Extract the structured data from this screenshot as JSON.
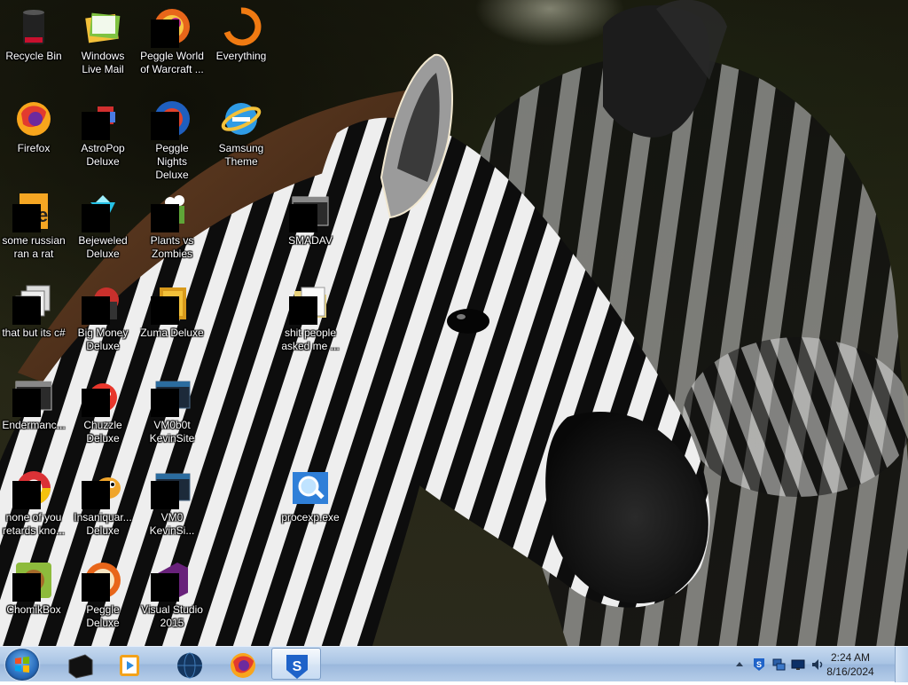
{
  "desktop": {
    "icons": [
      {
        "label": "Recycle Bin",
        "icon": "recycle-bin-icon",
        "redacted": false
      },
      {
        "label": "Windows Live Mail",
        "icon": "windows-live-mail-icon",
        "redacted": false
      },
      {
        "label": "Peggle World of Warcraft ...",
        "icon": "peggle-wow-icon",
        "redacted": true
      },
      {
        "label": "Everything",
        "icon": "everything-search-icon",
        "redacted": false
      },
      {
        "label": "Firefox",
        "icon": "firefox-icon",
        "redacted": false
      },
      {
        "label": "AstroPop Deluxe",
        "icon": "astropop-icon",
        "redacted": true
      },
      {
        "label": "Peggle Nights Deluxe",
        "icon": "peggle-nights-icon",
        "redacted": true
      },
      {
        "label": "Samsung Theme",
        "icon": "ie-icon",
        "redacted": false
      },
      {
        "label": "some russian ran a rat",
        "icon": "shortcut-icon",
        "redacted": true
      },
      {
        "label": "Bejeweled Deluxe",
        "icon": "bejeweled-icon",
        "redacted": true
      },
      {
        "label": "Plants vs Zombies",
        "icon": "plants-vs-zombies-icon",
        "redacted": true
      },
      {
        "label": "SMADAV",
        "icon": "app-window-icon",
        "redacted": true
      },
      {
        "label": "that but its c#",
        "icon": "stacked-files-icon",
        "redacted": true
      },
      {
        "label": "Big Money Deluxe",
        "icon": "big-money-icon",
        "redacted": true
      },
      {
        "label": "Zuma Deluxe",
        "icon": "zuma-icon",
        "redacted": true
      },
      {
        "label": "shit people asked me ...",
        "icon": "folder-icon",
        "redacted": true
      },
      {
        "label": "Endermanc...",
        "icon": "app-window-icon",
        "redacted": true
      },
      {
        "label": "Chuzzle Deluxe",
        "icon": "chuzzle-icon",
        "redacted": true
      },
      {
        "label": "VM0b0t KevinSite",
        "icon": "vm-icon",
        "redacted": true
      },
      {
        "label": "none of you retards kno...",
        "icon": "chrome-icon",
        "redacted": true
      },
      {
        "label": "Insaniquar... Deluxe",
        "icon": "insaniquarium-icon",
        "redacted": true
      },
      {
        "label": "VM0 KevinSi...",
        "icon": "vm-icon",
        "redacted": true
      },
      {
        "label": "procexp.exe",
        "icon": "process-explorer-icon",
        "redacted": false
      },
      {
        "label": "ChomikBox",
        "icon": "chomikbox-icon",
        "redacted": true
      },
      {
        "label": "Peggle Deluxe",
        "icon": "peggle-icon",
        "redacted": true
      },
      {
        "label": "Visual Studio 2015",
        "icon": "visual-studio-icon",
        "redacted": true
      }
    ]
  },
  "taskbar": {
    "start_label": "Start",
    "pinned": [
      {
        "name": "taskbar-app-terminal",
        "icon": "black-box-icon",
        "active": false
      },
      {
        "name": "taskbar-app-media-player",
        "icon": "media-player-icon",
        "active": false
      },
      {
        "name": "taskbar-app-globe",
        "icon": "globe-icon",
        "active": false
      },
      {
        "name": "taskbar-app-firefox",
        "icon": "firefox-icon",
        "active": false
      },
      {
        "name": "taskbar-app-sophos",
        "icon": "shield-s-icon",
        "active": true
      }
    ],
    "tray": {
      "icons": [
        "show-hidden-icons-chevron",
        "sophos-tray-icon",
        "network-icon",
        "monitor-icon",
        "volume-icon"
      ],
      "time": "2:24 AM",
      "date": "8/16/2024"
    }
  },
  "colors": {
    "taskbar_top": "#c6d9ef",
    "taskbar_bottom": "#9ab7dc",
    "label_text": "#ffffff"
  }
}
